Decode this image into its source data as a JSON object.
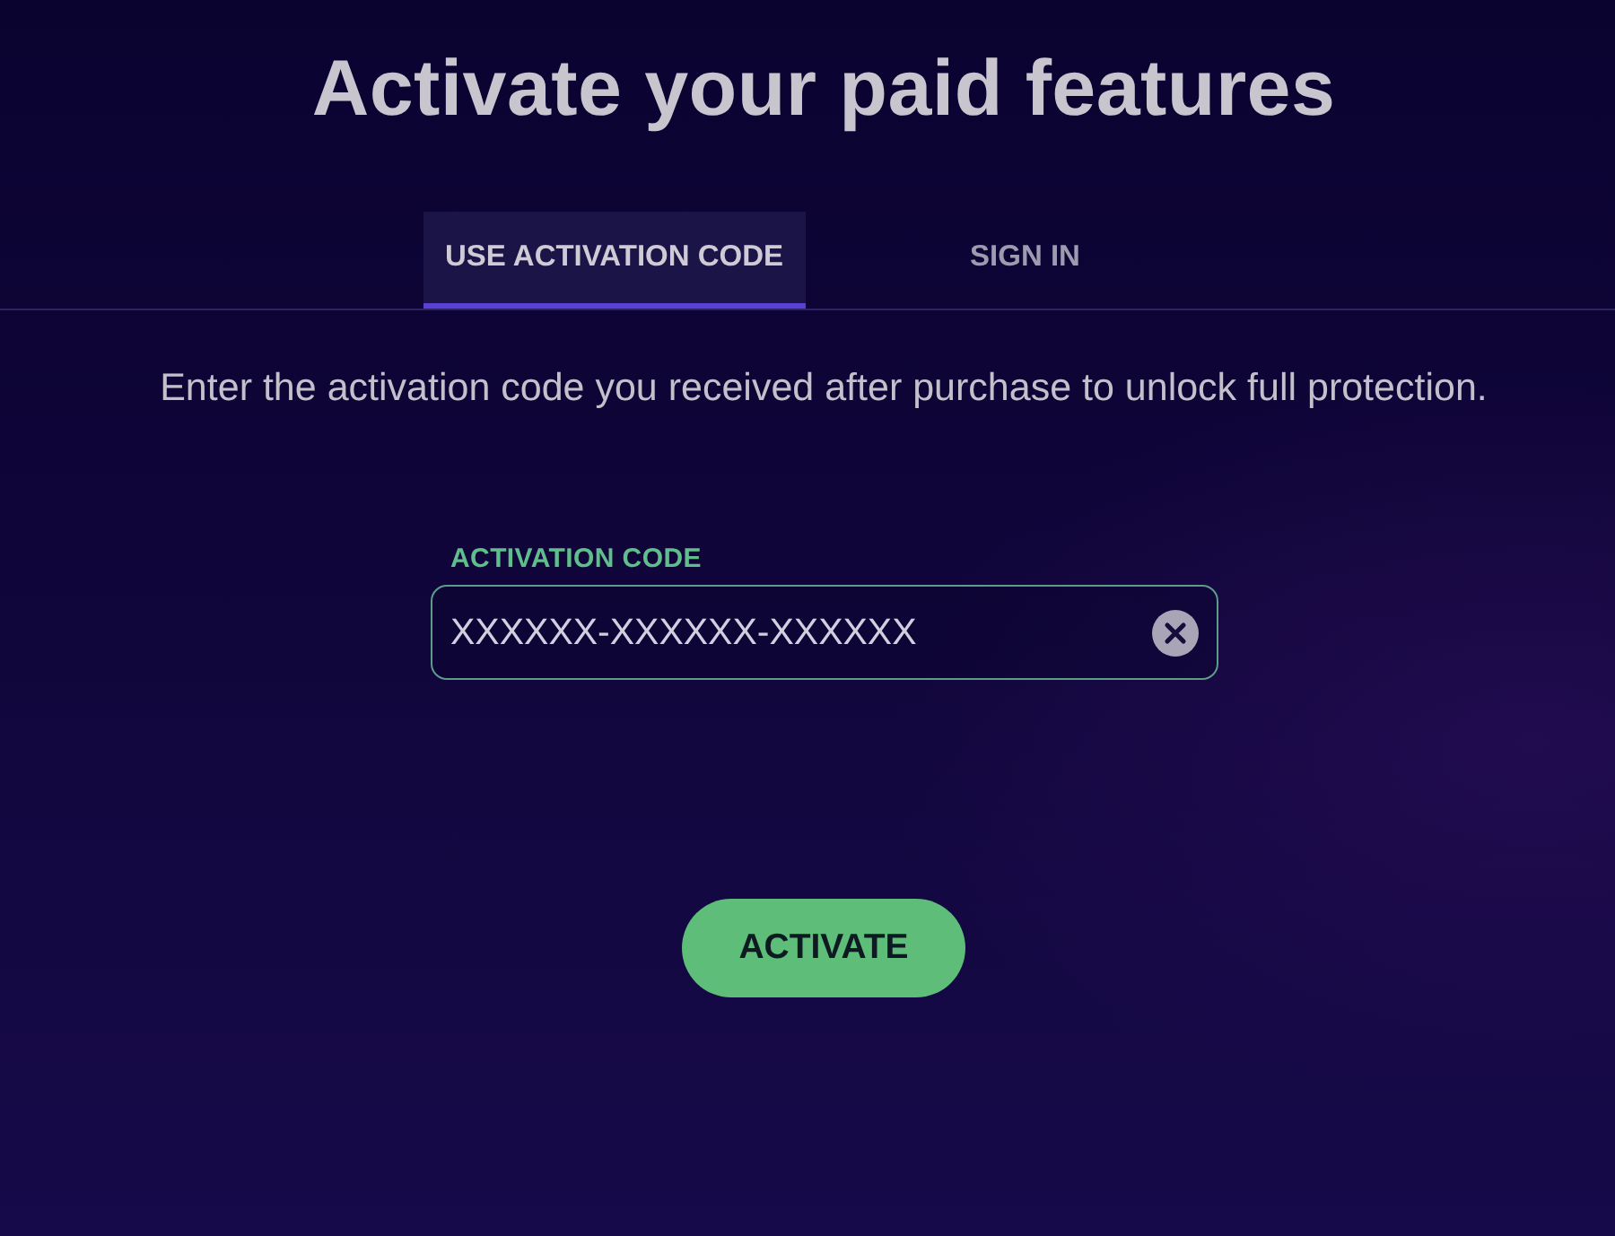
{
  "title": "Activate your paid features",
  "tabs": [
    {
      "label": "USE ACTIVATION CODE",
      "selected": true
    },
    {
      "label": "SIGN IN",
      "selected": false
    }
  ],
  "description": "Enter the activation code you received after purchase to unlock full protection.",
  "activation_field": {
    "label": "ACTIVATION CODE",
    "value": "XXXXXX-XXXXXX-XXXXXX"
  },
  "buttons": [
    "ACTIVATE"
  ]
}
